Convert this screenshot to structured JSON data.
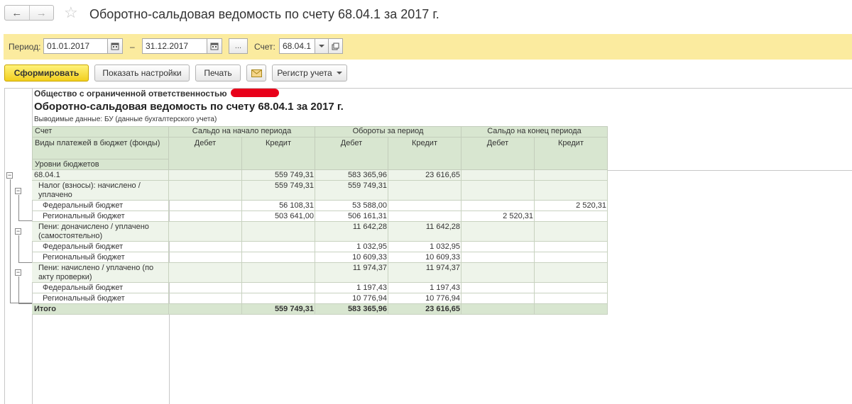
{
  "window": {
    "title": "Оборотно-сальдовая ведомость по счету 68.04.1 за 2017 г.",
    "back_icon": "←",
    "forward_icon": "→",
    "star_icon": "☆"
  },
  "period_bar": {
    "period_label": "Период:",
    "date_from": "01.01.2017",
    "dash": "–",
    "date_to": "31.12.2017",
    "choose_label": "...",
    "account_label": "Счет:",
    "account_value": "68.04.1"
  },
  "toolbar": {
    "generate": "Сформировать",
    "settings": "Показать настройки",
    "print": "Печать",
    "register": "Регистр учета"
  },
  "report": {
    "organization": "Общество с ограниченной ответственностью",
    "title": "Оборотно-сальдовая ведомость по счету 68.04.1 за 2017 г.",
    "subtitle": "Выводимые данные:  БУ (данные бухгалтерского учета)",
    "headers": {
      "account": "Счет",
      "subaccount1": "Виды платежей в бюджет (фонды)",
      "subaccount2": "Уровни бюджетов",
      "opening": "Сальдо на начало периода",
      "turnover": "Обороты за период",
      "closing": "Сальдо на конец периода",
      "debit": "Дебет",
      "credit": "Кредит"
    },
    "rows": [
      {
        "label": "68.04.1",
        "v": [
          "",
          "559 749,31",
          "583 365,96",
          "23 616,65",
          "",
          ""
        ]
      },
      {
        "label": "Налог (взносы): начислено / уплачено",
        "v": [
          "",
          "559 749,31",
          "559 749,31",
          "",
          "",
          ""
        ]
      },
      {
        "label": "Федеральный бюджет",
        "v": [
          "",
          "56 108,31",
          "53 588,00",
          "",
          "",
          "2 520,31"
        ]
      },
      {
        "label": "Региональный бюджет",
        "v": [
          "",
          "503 641,00",
          "506 161,31",
          "",
          "2 520,31",
          ""
        ]
      },
      {
        "label": "Пени: доначислено / уплачено (самостоятельно)",
        "v": [
          "",
          "",
          "11 642,28",
          "11 642,28",
          "",
          ""
        ]
      },
      {
        "label": "Федеральный бюджет",
        "v": [
          "",
          "",
          "1 032,95",
          "1 032,95",
          "",
          ""
        ]
      },
      {
        "label": "Региональный бюджет",
        "v": [
          "",
          "",
          "10 609,33",
          "10 609,33",
          "",
          ""
        ]
      },
      {
        "label": "Пени: начислено / уплачено (по акту проверки)",
        "v": [
          "",
          "",
          "11 974,37",
          "11 974,37",
          "",
          ""
        ]
      },
      {
        "label": "Федеральный бюджет",
        "v": [
          "",
          "",
          "1 197,43",
          "1 197,43",
          "",
          ""
        ]
      },
      {
        "label": "Региональный бюджет",
        "v": [
          "",
          "",
          "10 776,94",
          "10 776,94",
          "",
          ""
        ]
      }
    ],
    "total": {
      "label": "Итого",
      "v": [
        "",
        "559 749,31",
        "583 365,96",
        "23 616,65",
        "",
        ""
      ]
    },
    "minus_icon": "−"
  }
}
